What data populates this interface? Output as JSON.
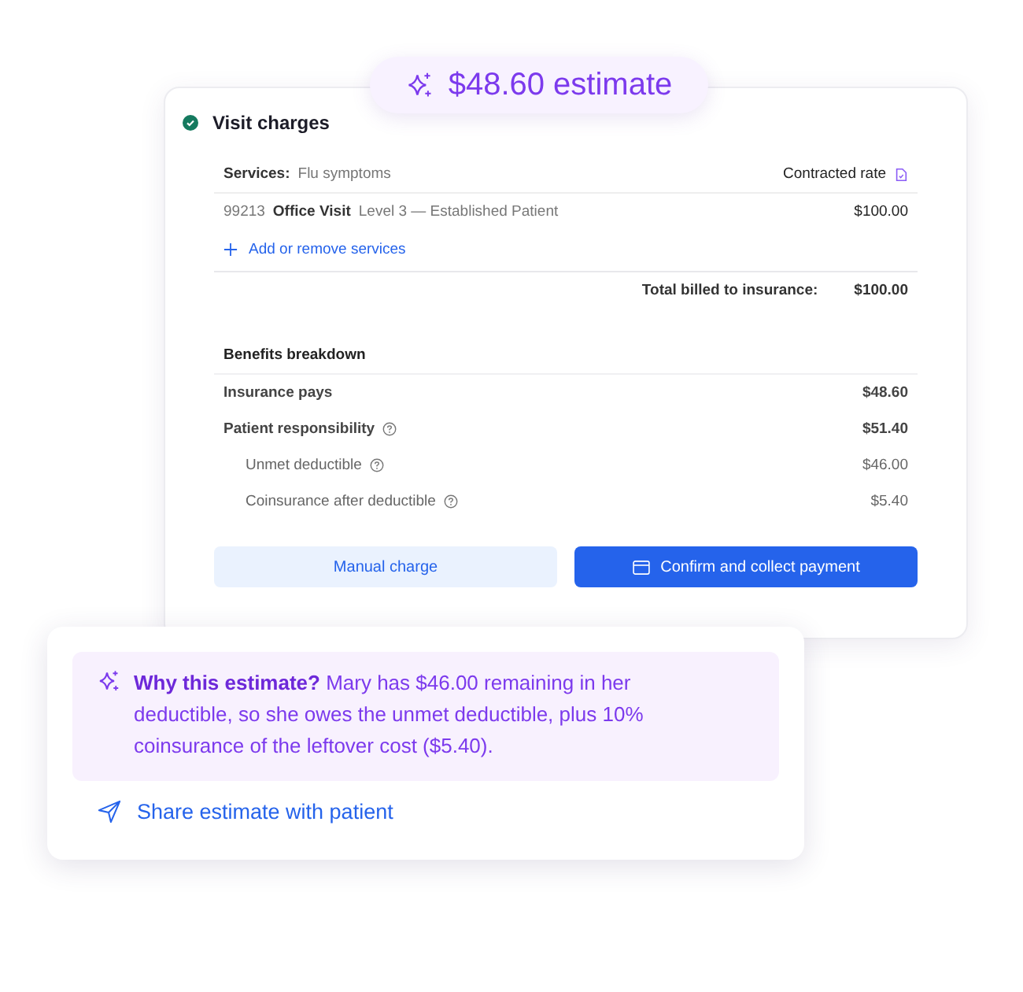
{
  "estimate_badge": {
    "text": "$48.60 estimate"
  },
  "card": {
    "title": "Visit charges",
    "complete": true,
    "services": {
      "label": "Services:",
      "value": "Flu symptoms",
      "rate_label": "Contracted rate"
    },
    "line_items": [
      {
        "code": "99213",
        "name": "Office Visit",
        "description": "Level 3 — Established Patient",
        "amount": "$100.00"
      }
    ],
    "add_link": "Add or remove services",
    "total": {
      "label": "Total billed to insurance:",
      "amount": "$100.00"
    },
    "breakdown": {
      "title": "Benefits breakdown",
      "rows": [
        {
          "kind": "main",
          "label": "Insurance pays",
          "amount": "$48.60",
          "help": false
        },
        {
          "kind": "main",
          "label": "Patient responsibility",
          "amount": "$51.40",
          "help": true
        },
        {
          "kind": "sub",
          "label": "Unmet deductible",
          "amount": "$46.00",
          "help": true
        },
        {
          "kind": "sub",
          "label": "Coinsurance after deductible",
          "amount": "$5.40",
          "help": true
        }
      ]
    },
    "buttons": [
      {
        "kind": "secondary",
        "label": "Manual charge"
      },
      {
        "kind": "primary",
        "label": "Confirm and collect payment"
      }
    ]
  },
  "explanation": {
    "text": "**Why this estimate?** Mary has $46.00 remaining in her deductible, so she owes the unmet deductible, plus 10% coinsurance of the leftover cost ($5.40).",
    "share_link": "Share estimate with patient"
  }
}
